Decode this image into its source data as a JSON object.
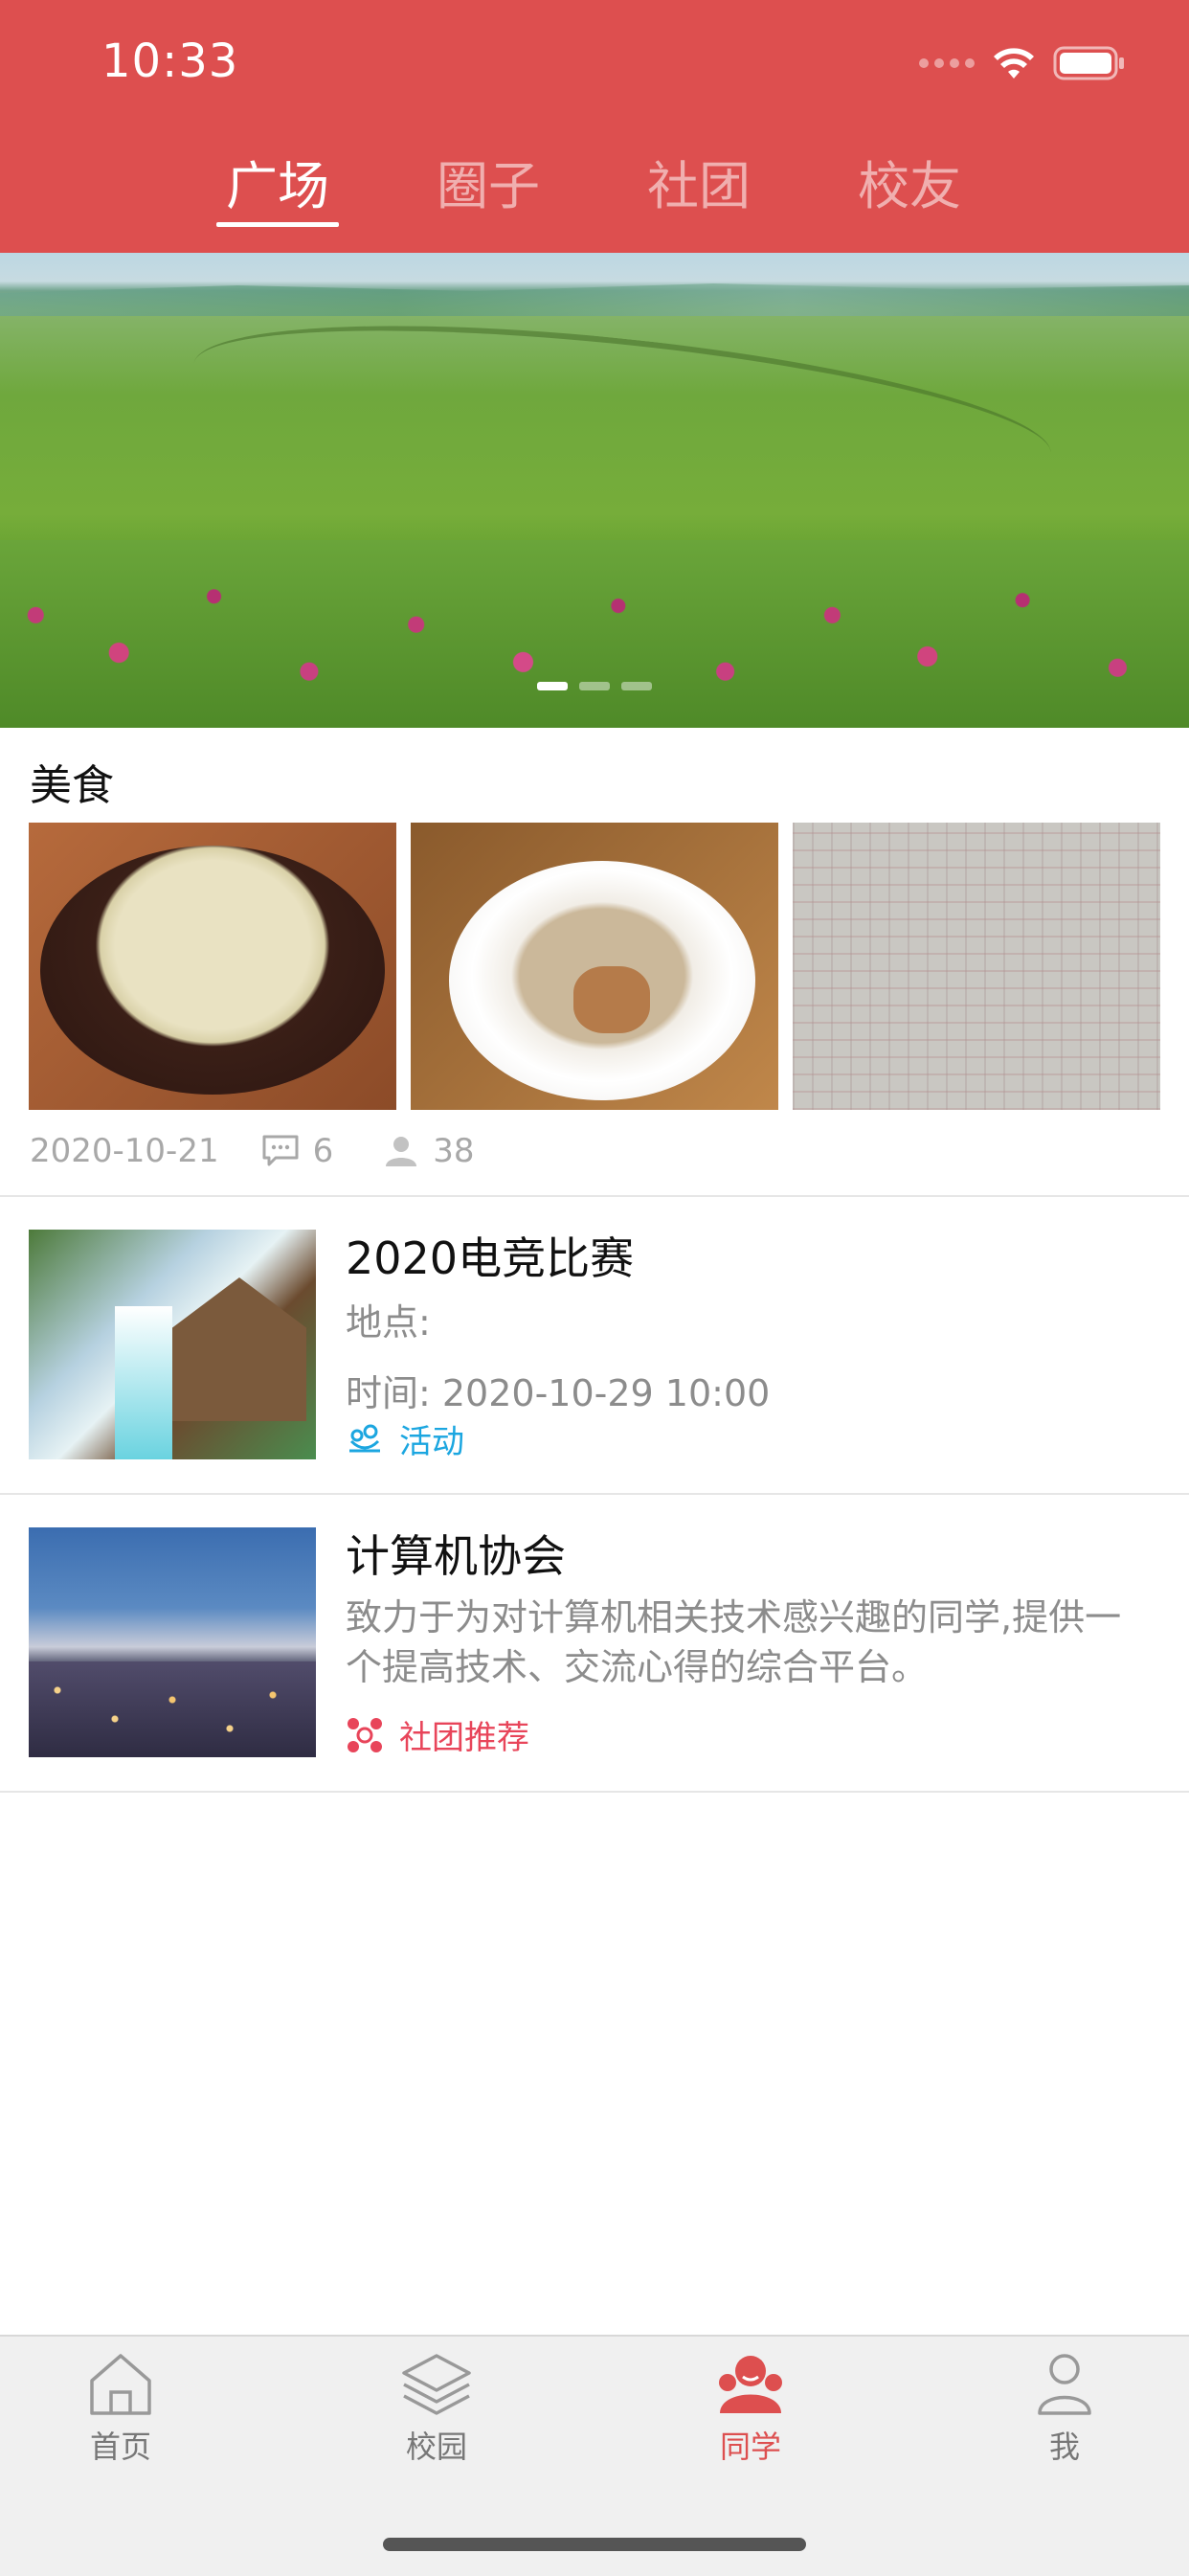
{
  "status_bar": {
    "time": "10:33"
  },
  "tabs": [
    {
      "label": "广场",
      "active": true
    },
    {
      "label": "圈子",
      "active": false
    },
    {
      "label": "社团",
      "active": false
    },
    {
      "label": "校友",
      "active": false
    }
  ],
  "banner": {
    "slide_count": 3,
    "active_slide": 1
  },
  "food_section": {
    "title": "美食",
    "date": "2020-10-21",
    "comments": "6",
    "views": "38"
  },
  "list": [
    {
      "title": "2020电竞比赛",
      "location_label": "地点:",
      "time": "时间: 2020-10-29 10:00",
      "tag": "活动",
      "tag_color": "#1ba6e0"
    },
    {
      "title": "计算机协会",
      "description": "致力于为对计算机相关技术感兴趣的同学,提供一个提高技术、交流心得的综合平台。",
      "tag": "社团推荐",
      "tag_color": "#e8455a"
    }
  ],
  "bottom_nav": [
    {
      "label": "首页",
      "icon": "home-icon",
      "active": false
    },
    {
      "label": "校园",
      "icon": "layers-icon",
      "active": false
    },
    {
      "label": "同学",
      "icon": "classmates-icon",
      "active": true
    },
    {
      "label": "我",
      "icon": "profile-icon",
      "active": false
    }
  ],
  "colors": {
    "primary": "#dd4f4f",
    "accent_blue": "#1ba6e0",
    "accent_red": "#e8455a"
  }
}
